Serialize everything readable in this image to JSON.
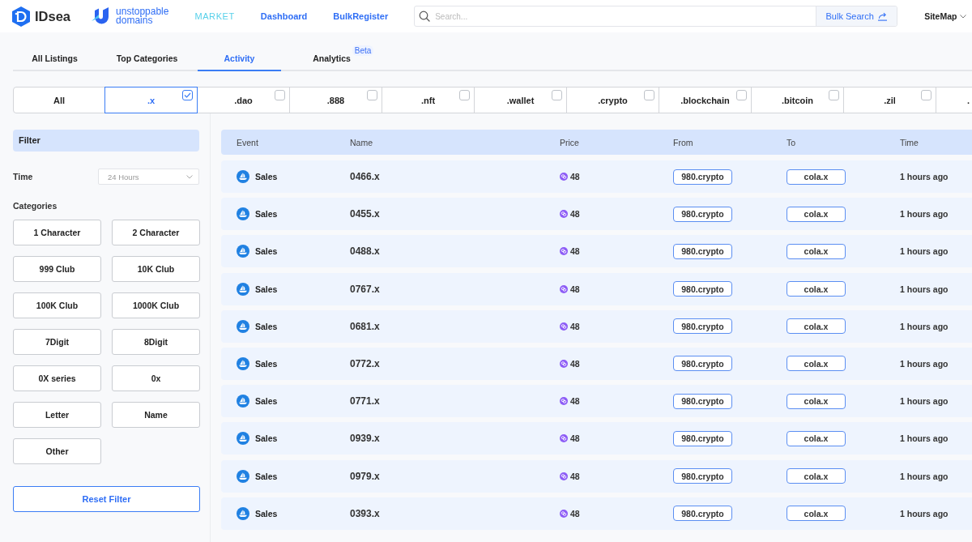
{
  "header": {
    "brand": "IDsea",
    "partner_brand": [
      "unstoppable",
      "domains"
    ],
    "nav": [
      {
        "label": "MARKET",
        "selected": true
      },
      {
        "label": "Dashboard",
        "selected": false
      },
      {
        "label": "BulkRegister",
        "selected": false
      }
    ],
    "search": {
      "placeholder": "Search...",
      "button": "Bulk Search"
    },
    "sitemap": "SiteMap"
  },
  "tabs": [
    {
      "label": "All Listings",
      "selected": false
    },
    {
      "label": "Top Categories",
      "selected": false
    },
    {
      "label": "Activity",
      "selected": true
    },
    {
      "label": "Analytics",
      "selected": false,
      "badge": "Beta"
    }
  ],
  "tld_filters": [
    {
      "kind": "all",
      "label": "All",
      "selected": false
    },
    {
      "kind": "tld",
      "label": ".x",
      "selected": true
    },
    {
      "kind": "tld",
      "label": ".dao",
      "selected": false
    },
    {
      "kind": "tld",
      "label": ".888",
      "selected": false
    },
    {
      "kind": "tld",
      "label": ".nft",
      "selected": false
    },
    {
      "kind": "tld",
      "label": ".wallet",
      "selected": false
    },
    {
      "kind": "tld",
      "label": ".crypto",
      "selected": false
    },
    {
      "kind": "tld",
      "label": ".blockchain",
      "selected": false
    },
    {
      "kind": "tld",
      "label": ".bitcoin",
      "selected": false
    },
    {
      "kind": "tld",
      "label": ".zil",
      "selected": false
    },
    {
      "kind": "partial",
      "label": ".",
      "selected": false
    }
  ],
  "filter": {
    "title": "Filter",
    "time": {
      "label": "Time",
      "value": "24 Hours"
    },
    "categories_label": "Categories",
    "categories": [
      {
        "label": "1 Character",
        "selected": false
      },
      {
        "label": "2 Character",
        "selected": false
      },
      {
        "label": "999 Club",
        "selected": false
      },
      {
        "label": "10K Club",
        "selected": false
      },
      {
        "label": "100K Club",
        "selected": false
      },
      {
        "label": "1000K Club",
        "selected": false
      },
      {
        "label": "7Digit",
        "selected": false
      },
      {
        "label": "8Digit",
        "selected": false
      },
      {
        "label": "0X series",
        "selected": false
      },
      {
        "label": "0x",
        "selected": false
      },
      {
        "label": "Letter",
        "selected": false
      },
      {
        "label": "Name",
        "selected": false
      },
      {
        "label": "Other",
        "selected": false
      }
    ],
    "reset": "Reset Filter"
  },
  "table": {
    "columns": [
      "Event",
      "Name",
      "Price",
      "From",
      "To",
      "Time"
    ],
    "rows": [
      {
        "event": "Sales",
        "name": "0466.x",
        "price": "48",
        "from": "980.crypto",
        "to": "cola.x",
        "time": "1 hours ago"
      },
      {
        "event": "Sales",
        "name": "0455.x",
        "price": "48",
        "from": "980.crypto",
        "to": "cola.x",
        "time": "1 hours ago"
      },
      {
        "event": "Sales",
        "name": "0488.x",
        "price": "48",
        "from": "980.crypto",
        "to": "cola.x",
        "time": "1 hours ago"
      },
      {
        "event": "Sales",
        "name": "0767.x",
        "price": "48",
        "from": "980.crypto",
        "to": "cola.x",
        "time": "1 hours ago"
      },
      {
        "event": "Sales",
        "name": "0681.x",
        "price": "48",
        "from": "980.crypto",
        "to": "cola.x",
        "time": "1 hours ago"
      },
      {
        "event": "Sales",
        "name": "0772.x",
        "price": "48",
        "from": "980.crypto",
        "to": "cola.x",
        "time": "1 hours ago"
      },
      {
        "event": "Sales",
        "name": "0771.x",
        "price": "48",
        "from": "980.crypto",
        "to": "cola.x",
        "time": "1 hours ago"
      },
      {
        "event": "Sales",
        "name": "0939.x",
        "price": "48",
        "from": "980.crypto",
        "to": "cola.x",
        "time": "1 hours ago"
      },
      {
        "event": "Sales",
        "name": "0979.x",
        "price": "48",
        "from": "980.crypto",
        "to": "cola.x",
        "time": "1 hours ago"
      },
      {
        "event": "Sales",
        "name": "0393.x",
        "price": "48",
        "from": "980.crypto",
        "to": "cola.x",
        "time": "1 hours ago"
      }
    ]
  }
}
